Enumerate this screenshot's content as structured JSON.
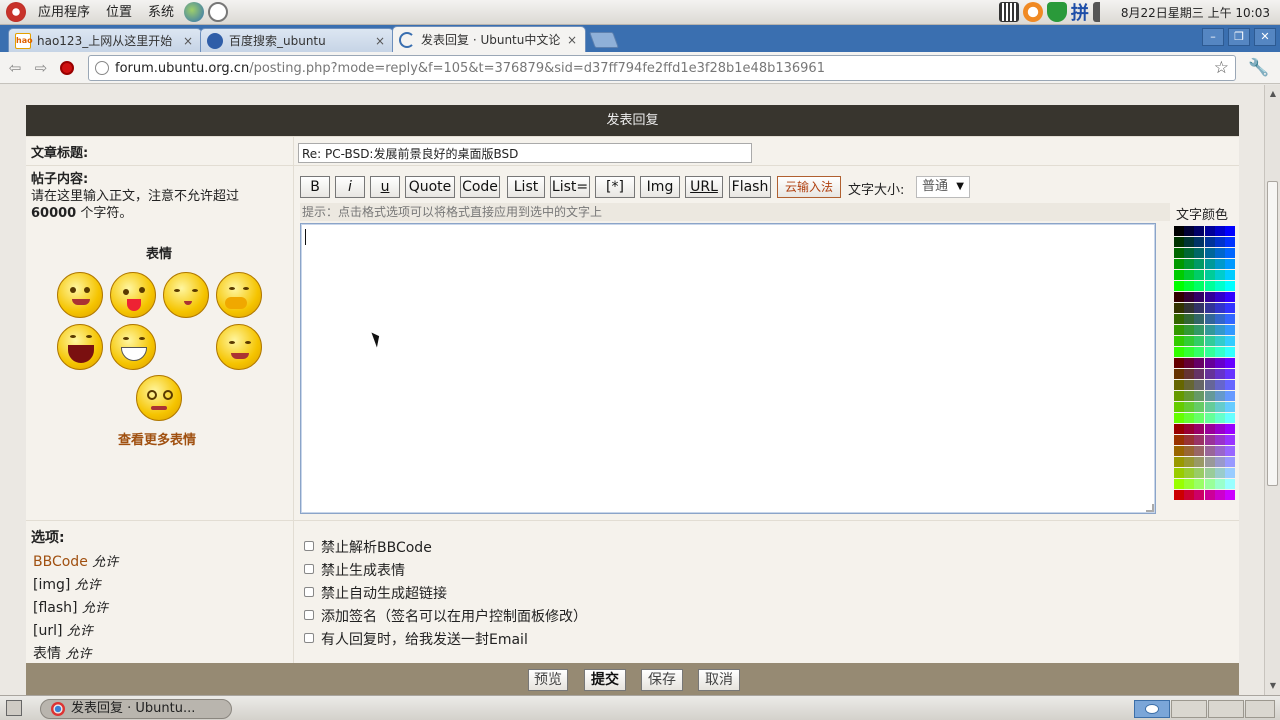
{
  "panel": {
    "menus": [
      "应用程序",
      "位置",
      "系统"
    ],
    "datetime": "8月22日星期三 上午 10:03",
    "input_method": "拼"
  },
  "tabs": [
    {
      "title": "hao123_上网从这里开始",
      "favicon_text": "hao",
      "close": "×"
    },
    {
      "title": "百度搜索_ubuntu",
      "close": "×"
    },
    {
      "title": "发表回复 · Ubuntu中文论",
      "close": "×",
      "active": true
    }
  ],
  "window_controls": [
    "–",
    "❐",
    "✕"
  ],
  "toolbar": {
    "url_host": "forum.ubuntu.org.cn",
    "url_path": "/posting.php?mode=reply&f=105&t=376879&sid=d37ff794fe2ffd1e3f28b1e48b136961"
  },
  "form": {
    "header": "发表回复",
    "subject_label": "文章标题:",
    "subject_value": "Re: PC-BSD:发展前景良好的桌面版BSD",
    "body_label": "帖子内容:",
    "body_hint_1": "请在这里输入正文，注意不允许超过",
    "body_hint_limit": "60000",
    "body_hint_2": "个字符。",
    "smilies_title": "表情",
    "more_smilies": "查看更多表情",
    "format_buttons": [
      "B",
      "i",
      "u",
      "Quote",
      "Code",
      "List",
      "List=",
      "[*]",
      "Img",
      "URL",
      "Flash"
    ],
    "cloud_ime": "云输入法",
    "font_size_label": "文字大小:",
    "font_size_value": "普通",
    "tip": "提示：点击格式选项可以将格式直接应用到选中的文字上",
    "text_color_label": "文字颜色",
    "options_label": "选项:",
    "status": [
      {
        "name": "BBCode",
        "value": "允许"
      },
      {
        "name": "[img]",
        "value": "允许"
      },
      {
        "name": "[flash]",
        "value": "允许"
      },
      {
        "name": "[url]",
        "value": "允许"
      },
      {
        "name": "表情",
        "value": "允许"
      }
    ],
    "checkboxes": [
      "禁止解析BBCode",
      "禁止生成表情",
      "禁止自动生成超链接",
      "添加签名（签名可以在用户控制面板修改）",
      "有人回复时，给我发送一封Email"
    ],
    "buttons": [
      "预览",
      "提交",
      "保存",
      "取消"
    ]
  },
  "taskbar": {
    "item": "发表回复 · Ubuntu..."
  }
}
